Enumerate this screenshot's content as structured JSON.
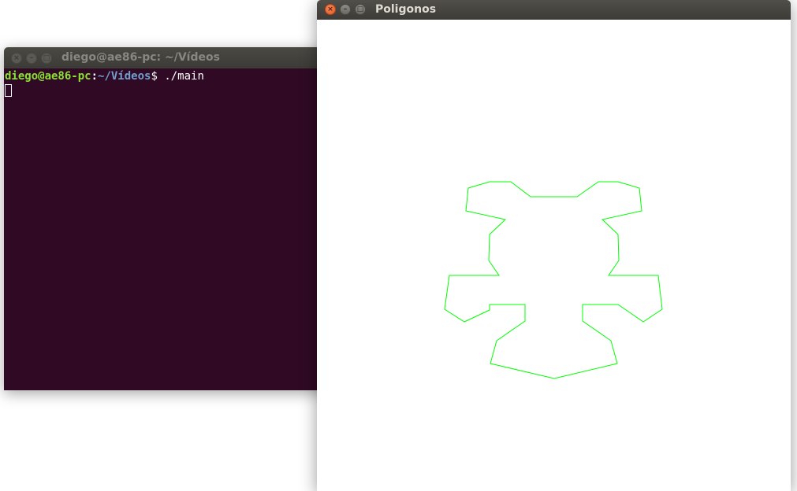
{
  "terminal": {
    "title": "diego@ae86-pc: ~/Vídeos",
    "prompt_user": "diego@ae86-pc",
    "prompt_colon": ":",
    "prompt_path": "~/Vídeos",
    "prompt_symbol": "$",
    "command": " ./main",
    "background_color": "#300a24"
  },
  "poly_window": {
    "title": "Poligonos",
    "stroke_color": "#00ff00",
    "background_color": "#ffffff"
  },
  "window_buttons": {
    "close_glyph": "×",
    "minimize_glyph": "–",
    "maximize_glyph": "□"
  }
}
